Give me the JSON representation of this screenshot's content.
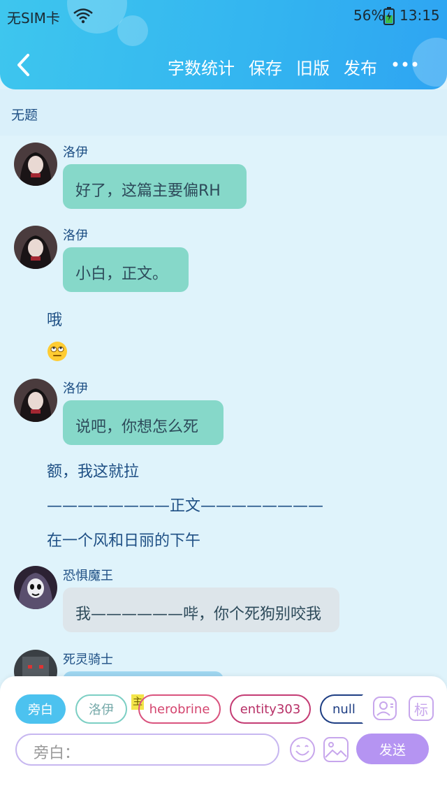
{
  "statusbar": {
    "carrier": "无SIM卡",
    "battery": "56%",
    "time": "13:15"
  },
  "header": {
    "actions": [
      "字数统计",
      "保存",
      "旧版",
      "发布"
    ]
  },
  "document": {
    "title": "无题"
  },
  "messages": [
    {
      "speaker": "洛伊",
      "text": "好了，这篇主要偏RH"
    },
    {
      "speaker": "洛伊",
      "text": "小白，正文。"
    },
    {
      "text": "哦"
    },
    {
      "speaker": "洛伊",
      "text": "说吧，你想怎么死"
    },
    {
      "text": "额，我这就拉"
    },
    {
      "text": "————————正文————————"
    },
    {
      "text": "在一个风和日丽的下午"
    },
    {
      "speaker": "恐惧魔王",
      "text": "我——————哔，你个死狗别咬我"
    },
    {
      "speaker": "死灵骑士"
    }
  ],
  "composer": {
    "roles": [
      "旁白",
      "洛伊",
      "herobrine",
      "entity303",
      "null"
    ],
    "main_tag": "主",
    "icon_label": "标",
    "placeholder": "旁白：",
    "send": "发送"
  },
  "colors": {
    "header": "#33b4f0",
    "teal_bubble": "#86d8c9",
    "grey_bubble": "#dde5ea",
    "send": "#b594f2"
  }
}
